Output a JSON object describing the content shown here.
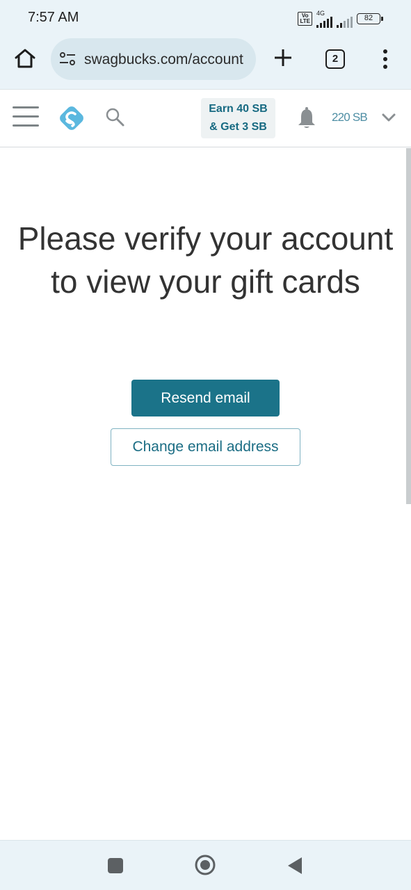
{
  "status_bar": {
    "time": "7:57 AM",
    "volte_label_1": "Vo",
    "volte_label_2": "LTE",
    "network_type": "4G",
    "battery_level": "82"
  },
  "browser": {
    "url": "swagbucks.com/account",
    "tab_count": "2",
    "icons": [
      "home-icon",
      "site-settings-icon",
      "new-tab-icon",
      "tab-switcher-icon",
      "more-vert-icon"
    ]
  },
  "site_header": {
    "promo_line_1": "Earn 40 SB",
    "promo_line_2": "& Get 3 SB",
    "balance": "220 SB",
    "icons": [
      "hamburger-menu-icon",
      "swagbucks-logo",
      "search-icon",
      "bell-icon",
      "chevron-down-icon"
    ]
  },
  "main": {
    "headline": "Please verify your account to view your gift cards",
    "resend_label": "Resend email",
    "change_label": "Change email address"
  },
  "colors": {
    "brand_teal": "#1b7389",
    "chrome_background": "#eaf3f8",
    "url_pill": "#d8e7ee",
    "logo_blue": "#5bb8df"
  },
  "nav_bar": {
    "icons": [
      "recent-apps-icon",
      "home-circle-icon",
      "back-icon"
    ]
  }
}
